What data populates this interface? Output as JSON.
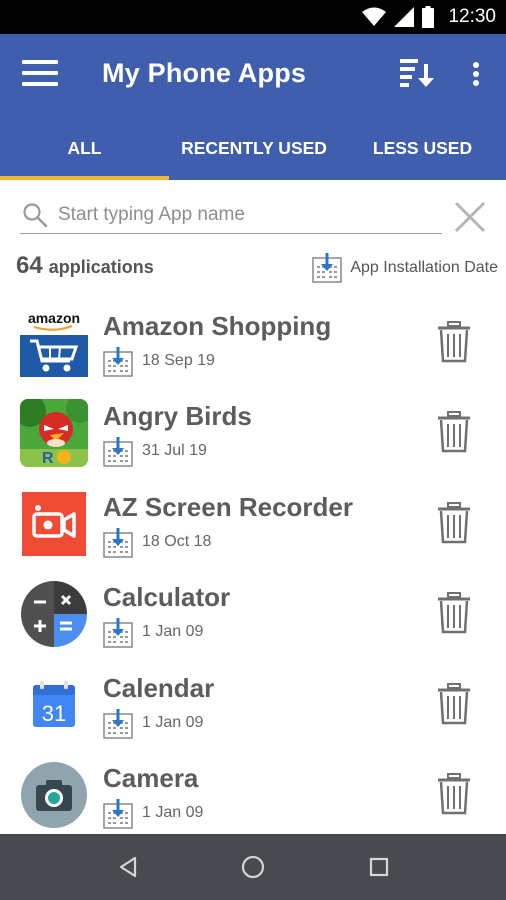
{
  "status_bar": {
    "time": "12:30",
    "icons": [
      "wifi-icon",
      "signal-icon",
      "battery-icon"
    ]
  },
  "app_bar": {
    "title": "My Phone Apps",
    "color": "#3f5fae",
    "icons": [
      "menu-icon",
      "sort-icon",
      "more-vert-icon"
    ]
  },
  "tabs": [
    {
      "label": "ALL",
      "selected": true
    },
    {
      "label": "RECENTLY USED",
      "selected": false
    },
    {
      "label": "LESS USED",
      "selected": false
    }
  ],
  "tab_indicator_color": "#f2b531",
  "search": {
    "placeholder": "Start typing App name",
    "value": ""
  },
  "summary": {
    "count": "64",
    "count_label": "applications",
    "sort_label": "App Installation Date"
  },
  "apps": [
    {
      "name": "Amazon Shopping",
      "date": "18 Sep 19",
      "icon": "amazon-shopping-icon"
    },
    {
      "name": "Angry Birds",
      "date": "31 Jul 19",
      "icon": "angry-birds-icon"
    },
    {
      "name": "AZ Screen Recorder",
      "date": "18 Oct 18",
      "icon": "az-screen-recorder-icon"
    },
    {
      "name": "Calculator",
      "date": "1 Jan 09",
      "icon": "calculator-icon"
    },
    {
      "name": "Calendar",
      "date": "1 Jan 09",
      "icon": "calendar-icon",
      "icon_text": "31"
    },
    {
      "name": "Camera",
      "date": "1 Jan 09",
      "icon": "camera-icon"
    }
  ],
  "amazon_icon_text": "amazon",
  "nav_bar": {
    "icons": [
      "back-icon",
      "home-icon",
      "recents-icon"
    ]
  }
}
